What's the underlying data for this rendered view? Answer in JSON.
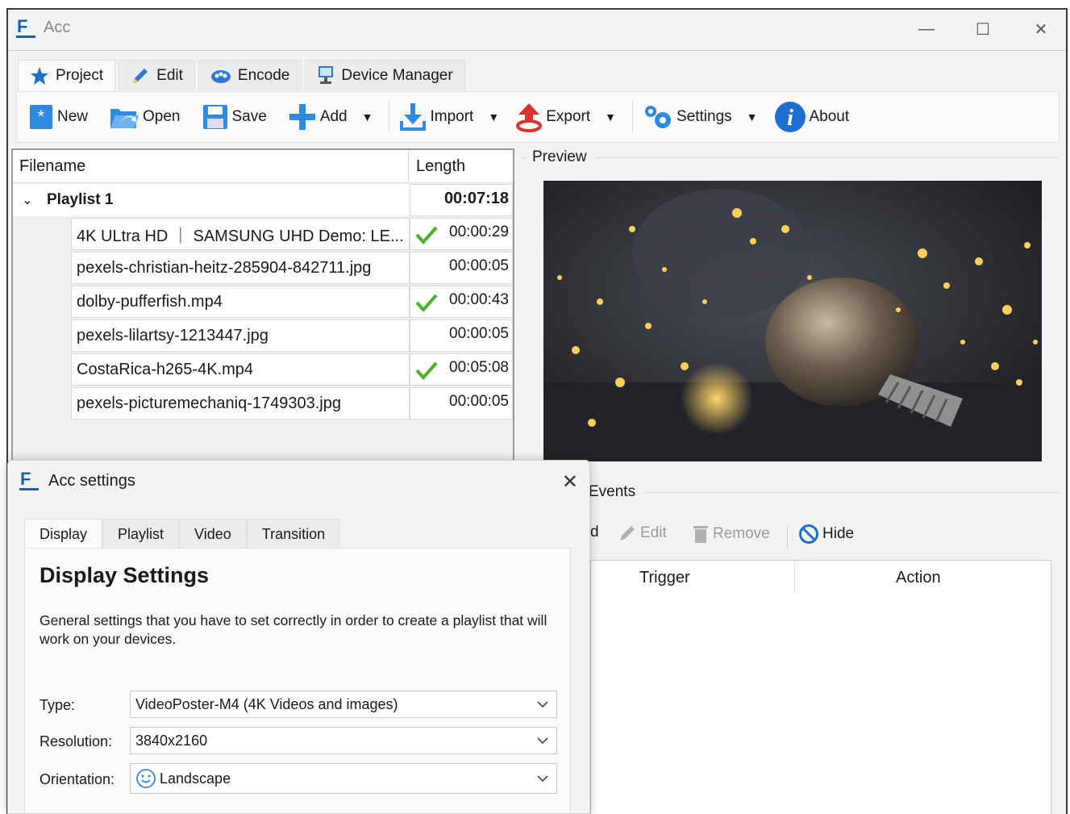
{
  "window": {
    "title": "Acc",
    "minimize": "—",
    "maximize": "☐",
    "close": "✕"
  },
  "ribbon_tabs": [
    {
      "label": "Project",
      "icon": "star-icon"
    },
    {
      "label": "Edit",
      "icon": "pencil-icon"
    },
    {
      "label": "Encode",
      "icon": "encode-icon"
    },
    {
      "label": "Device Manager",
      "icon": "monitor-icon"
    }
  ],
  "toolbar": {
    "new": "New",
    "open": "Open",
    "save": "Save",
    "add": "Add",
    "import": "Import",
    "export": "Export",
    "settings": "Settings",
    "about": "About"
  },
  "tree": {
    "col_filename": "Filename",
    "col_length": "Length",
    "playlist": {
      "name": "Playlist 1",
      "length": "00:07:18"
    },
    "items": [
      {
        "name": "4K ULtra HD ｜ SAMSUNG UHD Demo: LE...",
        "length": "00:00:29",
        "checked": true
      },
      {
        "name": "pexels-christian-heitz-285904-842711.jpg",
        "length": "00:00:05",
        "checked": false
      },
      {
        "name": "dolby-pufferfish.mp4",
        "length": "00:00:43",
        "checked": true
      },
      {
        "name": "pexels-lilartsy-1213447.jpg",
        "length": "00:00:05",
        "checked": false
      },
      {
        "name": "CostaRica-h265-4K.mp4",
        "length": "00:05:08",
        "checked": true
      },
      {
        "name": "pexels-picturemechaniq-1749303.jpg",
        "length": "00:00:05",
        "checked": false
      }
    ]
  },
  "preview": {
    "label": "Preview"
  },
  "events": {
    "label": "Events",
    "add_partial": "d",
    "edit": "Edit",
    "remove": "Remove",
    "hide": "Hide",
    "col_trigger": "Trigger",
    "col_action": "Action"
  },
  "dialog": {
    "title": "Acc settings",
    "close": "✕",
    "tabs": [
      "Display",
      "Playlist",
      "Video",
      "Transition"
    ],
    "heading": "Display Settings",
    "description": "General settings that you have to set correctly in order to create a playlist that will work on your devices.",
    "fields": {
      "type_label": "Type:",
      "type_value": "VideoPoster-M4 (4K Videos and images)",
      "resolution_label": "Resolution:",
      "resolution_value": "3840x2160",
      "orientation_label": "Orientation:",
      "orientation_value": "Landscape"
    }
  },
  "colors": {
    "accent": "#1f6fd0",
    "check": "#4caf2a",
    "export_red": "#d9342b"
  }
}
